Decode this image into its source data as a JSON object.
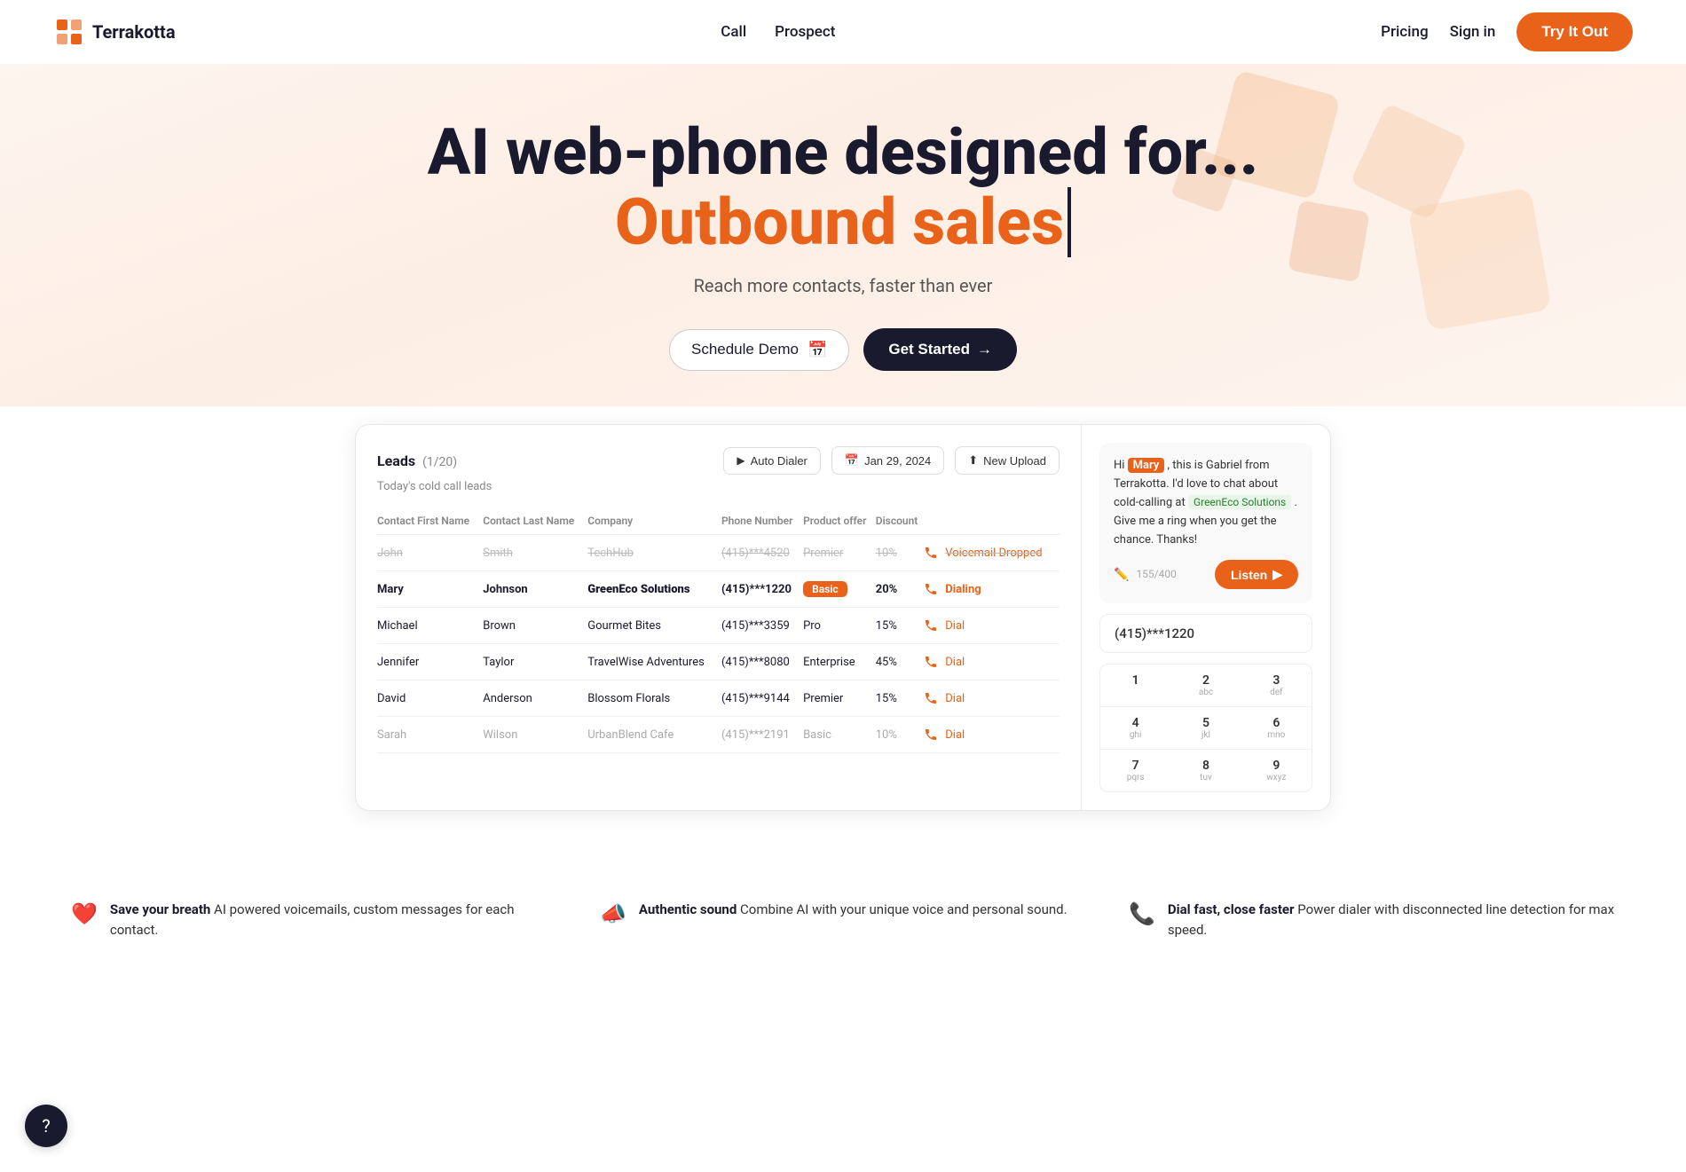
{
  "nav": {
    "logo_text": "Terrakotta",
    "links": [
      {
        "id": "call",
        "label": "Call"
      },
      {
        "id": "prospect",
        "label": "Prospect"
      }
    ],
    "pricing_label": "Pricing",
    "signin_label": "Sign in",
    "tryout_label": "Try It Out"
  },
  "hero": {
    "title_line1": "AI web-phone designed for...",
    "title_accent": "Outbound sales",
    "subtitle": "Reach more contacts, faster than ever",
    "btn_schedule": "Schedule Demo",
    "btn_getstarted": "Get Started"
  },
  "leads": {
    "title": "Leads",
    "count": "(1/20)",
    "subtitle": "Today's cold call leads",
    "btn_autodialer": "Auto Dialer",
    "btn_date": "Jan 29, 2024",
    "btn_newupload": "New Upload",
    "columns": [
      "Contact First Name",
      "Contact Last Name",
      "Company",
      "Phone Number",
      "Product offer",
      "Discount"
    ],
    "rows": [
      {
        "first": "John",
        "last": "Smith",
        "company": "TechHub",
        "phone": "(415)***4520",
        "product": "Premier",
        "discount": "10%",
        "status": "Voicemail Dropped",
        "muted": true,
        "active": false
      },
      {
        "first": "Mary",
        "last": "Johnson",
        "company": "GreenEco Solutions",
        "phone": "(415)***1220",
        "product": "Basic",
        "discount": "20%",
        "status": "Dialing",
        "muted": false,
        "active": true
      },
      {
        "first": "Michael",
        "last": "Brown",
        "company": "Gourmet Bites",
        "phone": "(415)***3359",
        "product": "Pro",
        "discount": "15%",
        "status": "Dial",
        "muted": false,
        "active": false
      },
      {
        "first": "Jennifer",
        "last": "Taylor",
        "company": "TravelWise Adventures",
        "phone": "(415)***8080",
        "product": "Enterprise",
        "discount": "45%",
        "status": "Dial",
        "muted": false,
        "active": false
      },
      {
        "first": "David",
        "last": "Anderson",
        "company": "Blossom Florals",
        "phone": "(415)***9144",
        "product": "Premier",
        "discount": "15%",
        "status": "Dial",
        "muted": false,
        "active": false
      },
      {
        "first": "Sarah",
        "last": "Wilson",
        "company": "UrbanBlend Cafe",
        "phone": "(415)***2191",
        "product": "Basic",
        "discount": "10%",
        "status": "Dial",
        "muted": false,
        "active": false,
        "dim": true
      }
    ]
  },
  "phone": {
    "message": {
      "prefix": "Hi",
      "name": "Mary",
      "middle": ", this is Gabriel from Terrakotta. I'd love to chat about cold-calling at",
      "company": "GreenEco Solutions",
      "suffix": ". Give me a ring when you get the chance. Thanks!",
      "char_count": "155/400",
      "btn_listen": "Listen"
    },
    "number": "(415)***1220",
    "dialpad": [
      {
        "key": "1",
        "sub": ""
      },
      {
        "key": "2",
        "sub": "abc"
      },
      {
        "key": "3",
        "sub": "def"
      },
      {
        "key": "4",
        "sub": "ghi"
      },
      {
        "key": "5",
        "sub": "jkl"
      },
      {
        "key": "6",
        "sub": "mno"
      },
      {
        "key": "7",
        "sub": "pqrs"
      },
      {
        "key": "8",
        "sub": "tuv"
      },
      {
        "key": "9",
        "sub": "wxyz"
      }
    ]
  },
  "features": [
    {
      "icon": "❤️",
      "strong": "Save your breath",
      "text": " AI powered voicemails, custom messages for each contact."
    },
    {
      "icon": "📣",
      "strong": "Authentic sound",
      "text": " Combine AI with your unique voice and personal sound."
    },
    {
      "icon": "📞",
      "strong": "Dial fast, close faster",
      "text": " Power dialer with disconnected line detection for max speed."
    }
  ],
  "chat_button": "?"
}
